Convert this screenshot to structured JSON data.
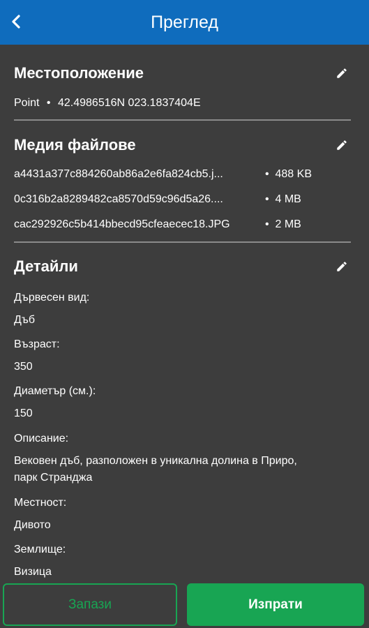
{
  "header": {
    "title": "Преглед",
    "back_icon": "chevron-left-icon"
  },
  "location": {
    "title": "Местоположение",
    "type": "Point",
    "separator": "•",
    "coordinates": "42.4986516N 023.1837404E"
  },
  "media": {
    "title": "Медия файлове",
    "files": [
      {
        "name": "a4431a377c884260ab86a2e6fa824cb5.j...",
        "size": "488 KB"
      },
      {
        "name": "0c316b2a8289482ca8570d59c96d5a26....",
        "size": "4 MB"
      },
      {
        "name": "cac292926c5b414bbecd95cfeaecec18.JPG",
        "size": "2 MB"
      }
    ]
  },
  "details": {
    "title": "Детайли",
    "fields": [
      {
        "label": "Дървесен вид:",
        "value": "Дъб"
      },
      {
        "label": "Възраст:",
        "value": "350"
      },
      {
        "label": "Диаметър (см.):",
        "value": "150"
      },
      {
        "label": "Описание:",
        "value": "Вековен дъб, разположен в уникална долина в Приро,",
        "value2": "парк Странджа"
      },
      {
        "label": "Местност:",
        "value": "Дивото"
      },
      {
        "label": "Землище:",
        "value": "Визица"
      }
    ]
  },
  "actions": {
    "save": "Запази",
    "send": "Изпрати"
  },
  "colors": {
    "header_bg": "#0f6cbd",
    "page_bg": "#3d3d3d",
    "accent_green": "#18a553"
  }
}
